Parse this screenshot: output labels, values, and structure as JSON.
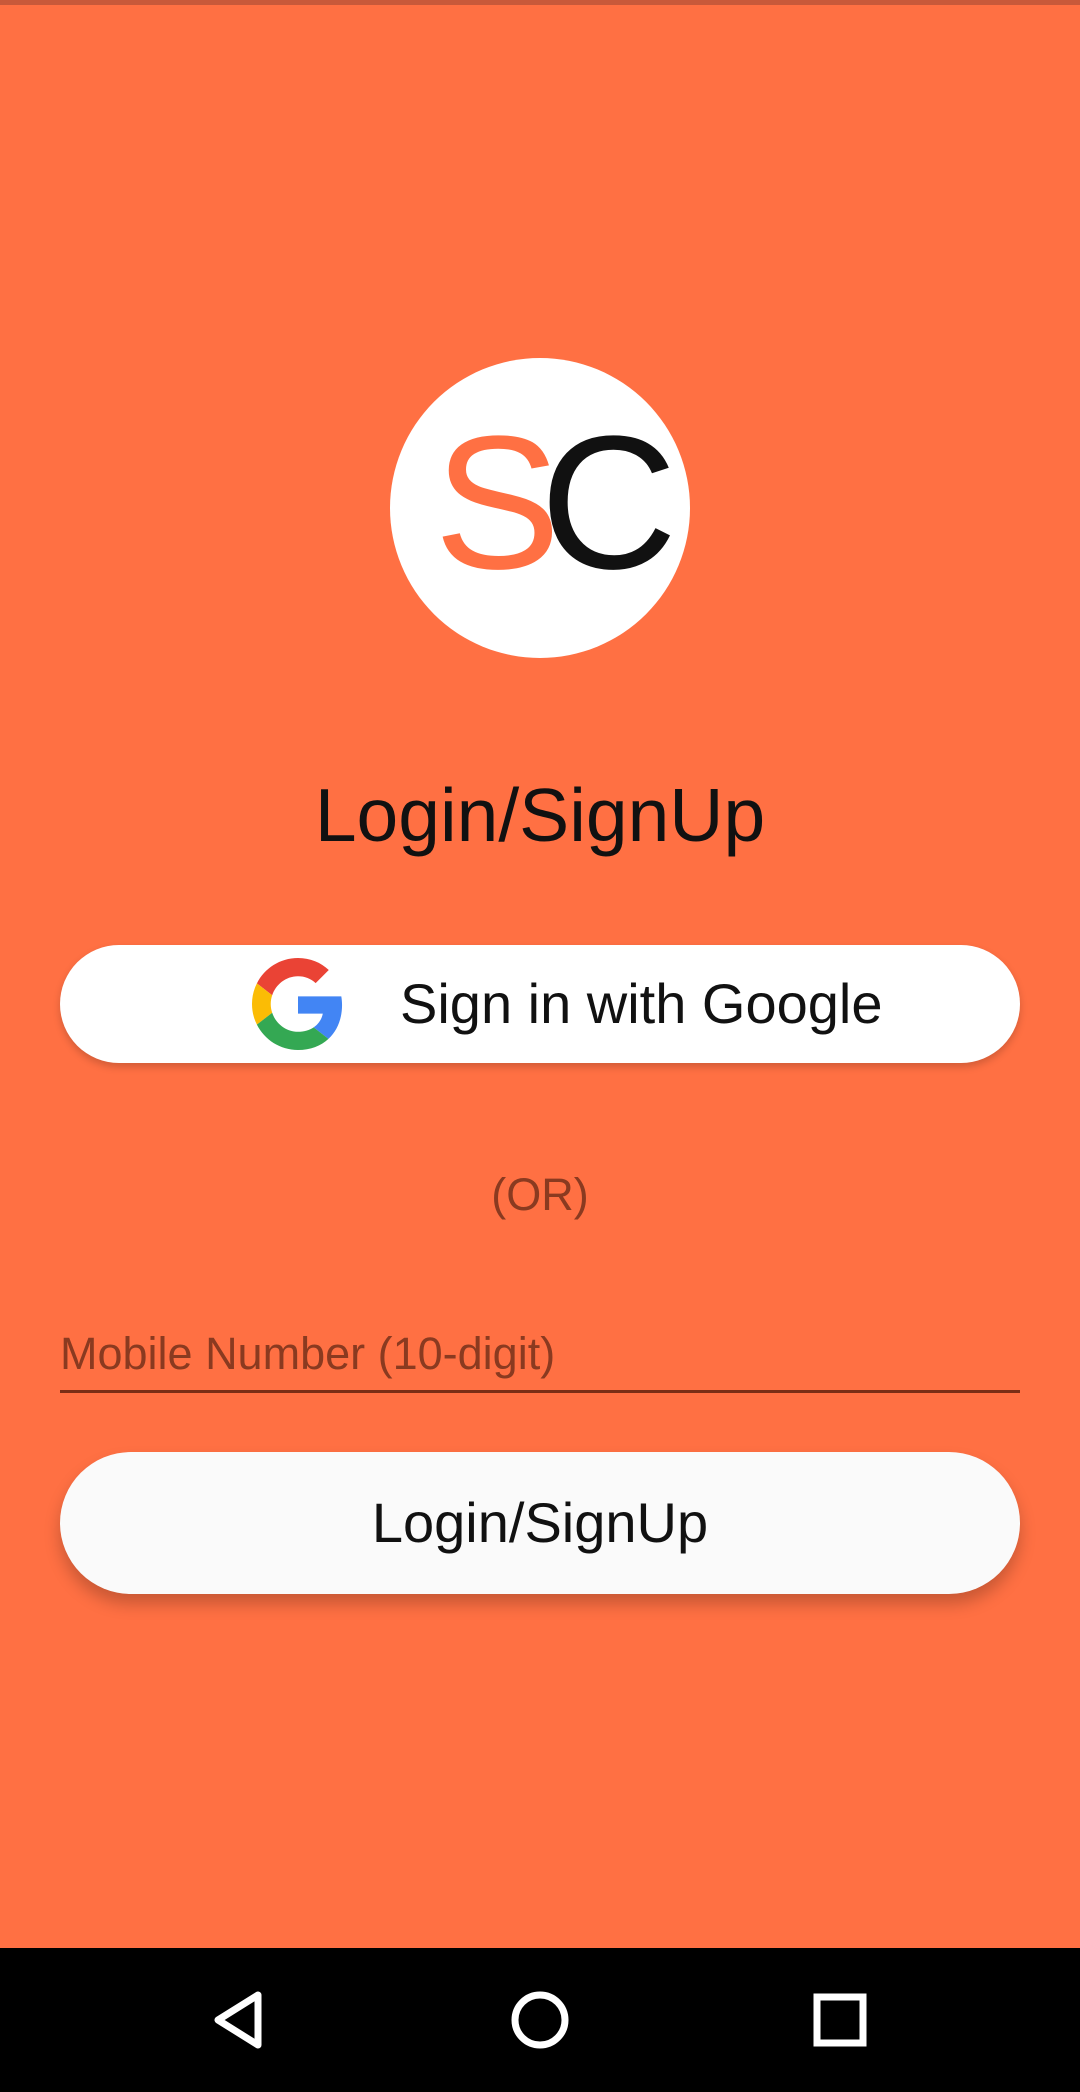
{
  "logo": {
    "letter_s": "S",
    "letter_c": "C",
    "icon": "sc-logo"
  },
  "header": {
    "title": "Login/SignUp"
  },
  "google_button": {
    "label": "Sign in with Google",
    "icon": "google-icon"
  },
  "divider": {
    "text": "(OR)"
  },
  "mobile_input": {
    "placeholder": "Mobile Number (10-digit)",
    "value": ""
  },
  "submit_button": {
    "label": "Login/SignUp"
  },
  "nav_bar": {
    "back_icon": "back-triangle-icon",
    "home_icon": "home-circle-icon",
    "recents_icon": "recents-square-icon"
  },
  "colors": {
    "background": "#FF7043",
    "logo_s": "#FF7043",
    "logo_c": "#111111",
    "nav_bar": "#000000",
    "button_bg": "#FFFFFF"
  }
}
